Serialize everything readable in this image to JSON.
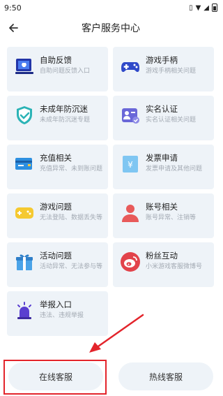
{
  "status_bar": {
    "time": "9:50"
  },
  "header": {
    "title": "客户服务中心"
  },
  "services": [
    {
      "title": "自助反馈",
      "subtitle": "自助问题反馈入口",
      "icon": "feedback-icon"
    },
    {
      "title": "游戏手柄",
      "subtitle": "游戏手柄相关问题",
      "icon": "gamepad-icon"
    },
    {
      "title": "未成年防沉迷",
      "subtitle": "未成年防沉迷专题",
      "icon": "shield-check-icon"
    },
    {
      "title": "实名认证",
      "subtitle": "实名认证相关问题",
      "icon": "id-card-icon"
    },
    {
      "title": "充值相关",
      "subtitle": "充值异常、未到账问题",
      "icon": "credit-card-icon"
    },
    {
      "title": "发票申请",
      "subtitle": "发票申请及其他问题",
      "icon": "invoice-icon"
    },
    {
      "title": "游戏问题",
      "subtitle": "无法登陆、数据丢失等",
      "icon": "game-controller-icon"
    },
    {
      "title": "账号相关",
      "subtitle": "账号异常、注销等",
      "icon": "user-icon"
    },
    {
      "title": "活动问题",
      "subtitle": "活动异常、无法参与等",
      "icon": "gift-icon"
    },
    {
      "title": "粉丝互动",
      "subtitle": "小米游戏客服微博号",
      "icon": "weibo-icon"
    },
    {
      "title": "举报入口",
      "subtitle": "违法、违规举报",
      "icon": "alarm-icon"
    }
  ],
  "footer": {
    "online_label": "在线客服",
    "hotline_label": "热线客服"
  },
  "colors": {
    "card_bg": "#eef3f8",
    "highlight": "#e3242b",
    "accent_blue": "#3b6fe0"
  }
}
